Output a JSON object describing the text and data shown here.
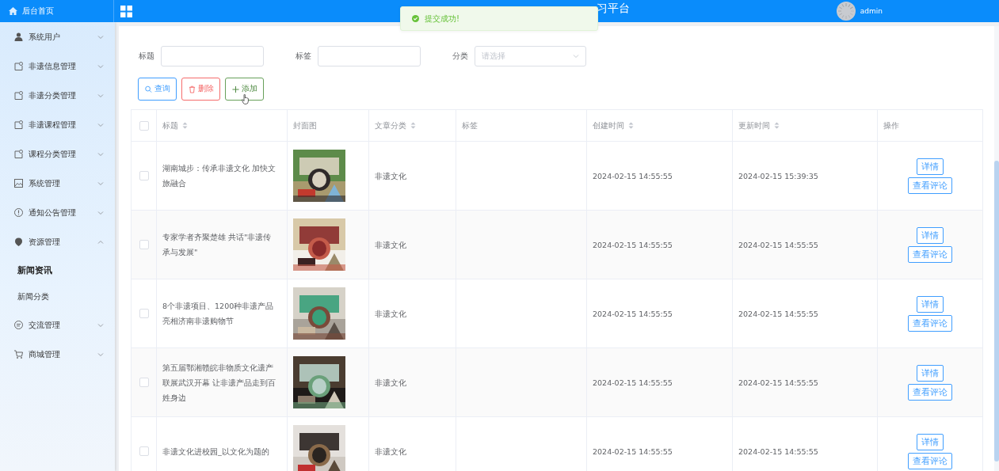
{
  "header": {
    "home": "后台首页",
    "title": "习平台",
    "user": "admin"
  },
  "toast": {
    "message": "提交成功!"
  },
  "sidebar": {
    "items": [
      {
        "label": "系统用户",
        "expanded": false
      },
      {
        "label": "非遗信息管理",
        "expanded": false
      },
      {
        "label": "非遗分类管理",
        "expanded": false
      },
      {
        "label": "非遗课程管理",
        "expanded": false
      },
      {
        "label": "课程分类管理",
        "expanded": false
      },
      {
        "label": "系统管理",
        "expanded": false
      },
      {
        "label": "通知公告管理",
        "expanded": false
      },
      {
        "label": "资源管理",
        "expanded": true,
        "children": [
          {
            "label": "新闻资讯",
            "selected": true
          },
          {
            "label": "新闻分类",
            "selected": false
          }
        ]
      },
      {
        "label": "交流管理",
        "expanded": false
      },
      {
        "label": "商城管理",
        "expanded": false
      }
    ]
  },
  "filters": [
    {
      "label": "标题",
      "kind": "text"
    },
    {
      "label": "标签",
      "kind": "text"
    },
    {
      "label": "分类",
      "kind": "select",
      "placeholder": "请选择"
    }
  ],
  "buttons": [
    {
      "label": "查询",
      "kind": "search"
    },
    {
      "label": "删除",
      "kind": "delete"
    },
    {
      "label": "添加",
      "kind": "add"
    }
  ],
  "table": {
    "header_checked": false,
    "columns": [
      {
        "label": "标题",
        "sortable": true
      },
      {
        "label": "封面图",
        "sortable": false
      },
      {
        "label": "文章分类",
        "sortable": true
      },
      {
        "label": "标签",
        "sortable": false
      },
      {
        "label": "创建时间",
        "sortable": true
      },
      {
        "label": "更新时间",
        "sortable": true
      },
      {
        "label": "操作",
        "sortable": false
      }
    ],
    "rows": [
      {
        "checked": false,
        "title": "湖南城步：传承非遗文化 加快文旅融合",
        "cover": {
          "kind": "picture"
        },
        "category": "非遗文化",
        "created": "2024-02-15 14:55:55",
        "updated": "2024-02-15 15:39:35",
        "actions": [
          "详情",
          "查看评论"
        ]
      },
      {
        "checked": false,
        "title": "专家学者齐聚楚雄 共话\"非遗传承与发展\"",
        "cover": {
          "kind": "picture"
        },
        "category": "非遗文化",
        "created": "2024-02-15 14:55:55",
        "updated": "2024-02-15 14:55:55",
        "actions": [
          "详情",
          "查看评论"
        ]
      },
      {
        "checked": false,
        "title": "8个非遗项目、1200种非遗产品亮相济南非遗购物节",
        "cover": {
          "kind": "picture"
        },
        "category": "非遗文化",
        "created": "2024-02-15 14:55:55",
        "updated": "2024-02-15 14:55:55",
        "actions": [
          "详情",
          "查看评论"
        ]
      },
      {
        "checked": false,
        "title": "第五届鄂湘赣皖非物质文化遗产联展武汉开幕 让非遗产品走到百姓身边",
        "cover": {
          "kind": "picture"
        },
        "category": "非遗文化",
        "created": "2024-02-15 14:55:55",
        "updated": "2024-02-15 14:55:55",
        "actions": [
          "详情",
          "查看评论"
        ]
      },
      {
        "checked": false,
        "title": "非遗文化进校园_以文化为题的",
        "cover": {
          "kind": "picture"
        },
        "category": "非遗文化",
        "created": "2024-02-15 14:55:55",
        "updated": "2024-02-15 14:55:55",
        "actions": [
          "详情",
          "查看评论"
        ]
      }
    ]
  }
}
